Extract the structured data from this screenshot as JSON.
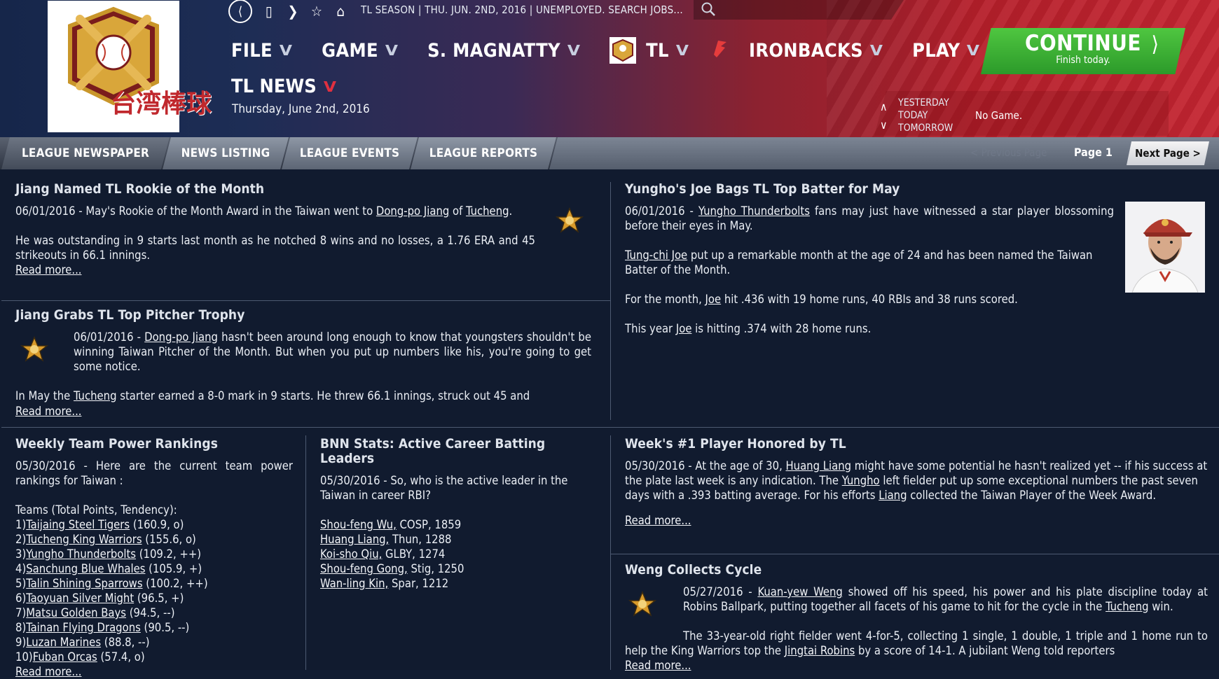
{
  "topbar": {
    "breadcrumb": "TL SEASON  |  THU. JUN. 2ND, 2016  |  UNEMPLOYED. SEARCH JOBS..."
  },
  "menus": {
    "file": "FILE",
    "game": "GAME",
    "manager": "S. MAGNATTY",
    "league": "TL",
    "team": "IRONBACKS",
    "play": "PLAY"
  },
  "page": {
    "title": "TL NEWS",
    "date": "Thursday, June 2nd, 2016"
  },
  "continue": {
    "label": "CONTINUE",
    "sub": "Finish today."
  },
  "days": {
    "yesterday": "YESTERDAY",
    "today": "TODAY",
    "tomorrow": "TOMORROW",
    "status": "No Game."
  },
  "tabs": {
    "newspaper": "LEAGUE NEWSPAPER",
    "listing": "NEWS LISTING",
    "events": "LEAGUE EVENTS",
    "reports": "LEAGUE REPORTS"
  },
  "pager": {
    "prev": "< Previous Page",
    "page": "Page 1",
    "next": "Next Page >"
  },
  "read_more": "Read more...",
  "a1": {
    "title": "Jiang Named TL Rookie of the Month",
    "p1_pre": "06/01/2016 - May's Rookie of the Month Award in the Taiwan  went to ",
    "p1_link1": "Dong-po Jiang",
    "p1_mid": " of ",
    "p1_link2": "Tucheng",
    "p1_post": ".",
    "p2": "He was outstanding in 9 starts last month as he notched 8 wins and no losses, a 1.76 ERA and 45 strikeouts in 66.1 innings."
  },
  "a2": {
    "title": "Jiang Grabs TL Top Pitcher Trophy",
    "p1_pre": "06/01/2016 - ",
    "p1_link": "Dong-po Jiang",
    "p1_post": " hasn't been around long enough to know that youngsters shouldn't be winning Taiwan  Pitcher of the Month. But when you put up numbers like his, you're going to get some notice.",
    "p2_pre": "In May the ",
    "p2_link": "Tucheng",
    "p2_post": " starter earned a 8-0 mark in 9 starts. He threw 66.1 innings, struck out 45 and"
  },
  "a3": {
    "title": "Yungho's Joe Bags TL Top Batter for May",
    "p1_pre": "06/01/2016 - ",
    "p1_link": "Yungho Thunderbolts",
    "p1_post": " fans may just have witnessed a star player blossoming before their eyes in May.",
    "p2_link": "Tung-chi Joe",
    "p2_post": " put up a remarkable month at the age of 24 and has been named the Taiwan  Batter of the Month.",
    "p3_pre": "For the month, ",
    "p3_link": "Joe",
    "p3_post": " hit .436 with 19 home runs, 40 RBIs and 38 runs scored.",
    "p4_pre": "This year ",
    "p4_link": "Joe",
    "p4_post": " is hitting .374 with 28 home runs."
  },
  "a4": {
    "title": "Weekly Team Power Rankings",
    "intro": "05/30/2016 - Here are the current team power rankings for Taiwan :",
    "header": "Teams (Total Points, Tendency):",
    "rankings": [
      {
        "num": "1)",
        "team": "Taijaing Steel Tigers",
        "stats": " (160.9, o)"
      },
      {
        "num": "2)",
        "team": "Tucheng King Warriors",
        "stats": " (155.6, o)"
      },
      {
        "num": "3)",
        "team": "Yungho Thunderbolts",
        "stats": " (109.2, ++)"
      },
      {
        "num": "4)",
        "team": "Sanchung Blue Whales",
        "stats": " (105.9, +)"
      },
      {
        "num": "5)",
        "team": "Talin Shining Sparrows",
        "stats": " (100.2, ++)"
      },
      {
        "num": "6)",
        "team": "Taoyuan Silver Might",
        "stats": " (96.5, +)"
      },
      {
        "num": "7)",
        "team": "Matsu Golden Bays",
        "stats": " (94.5, --)"
      },
      {
        "num": "8)",
        "team": "Tainan Flying Dragons",
        "stats": " (90.5, --)"
      },
      {
        "num": "9)",
        "team": "Luzan Marines",
        "stats": " (88.8, --)"
      },
      {
        "num": "10)",
        "team": "Fuban Orcas",
        "stats": " (57.4, o)"
      }
    ]
  },
  "a5": {
    "title": "BNN Stats: Active Career Batting Leaders",
    "intro": "05/30/2016 - So, who is the active leader in the Taiwan  in career RBI?",
    "leaders": [
      {
        "name": "Shou-feng Wu,",
        "stats": " COSP, 1859"
      },
      {
        "name": "Huang Liang,",
        "stats": " Thun, 1288"
      },
      {
        "name": "Koi-sho Qiu,",
        "stats": " GLBY, 1274"
      },
      {
        "name": "Shou-feng Gong,",
        "stats": " Stig, 1250"
      },
      {
        "name": "Wan-ling Kin,",
        "stats": " Spar, 1212"
      }
    ]
  },
  "a6": {
    "title": "Week's #1 Player Honored by TL",
    "p_pre": "05/30/2016 - At the age of 30, ",
    "p_link1": "Huang Liang",
    "p_mid1": " might have some potential he hasn't realized yet -- if his success at the plate last week is any indication. The ",
    "p_link2": "Yungho",
    "p_mid2": " left fielder put up some exceptional numbers the past seven days with a .393 batting average. For his efforts ",
    "p_link3": "Liang",
    "p_post": " collected the Taiwan  Player of the Week Award."
  },
  "a7": {
    "title": "Weng Collects Cycle",
    "p1_pre": "05/27/2016 - ",
    "p1_link1": "Kuan-yew Weng",
    "p1_mid": " showed off his speed, his power and his plate discipline today at Robins Ballpark, putting together all facets of his game to hit for the cycle in the ",
    "p1_link2": "Tucheng",
    "p1_post": " win.",
    "p2_pre": "The 33-year-old right fielder went 4-for-5, collecting 1 single, 1 double, 1 triple and 1 home run to help the King Warriors top the ",
    "p2_link": "Jingtai Robins",
    "p2_post": " by a score of 14-1. A jubilant Weng told reporters"
  },
  "logo_text": "台湾棒球",
  "colors": {
    "continue_green": "#3bb236",
    "header_red": "#c42531",
    "header_blue": "#16264a",
    "content_bg": "#111b2f"
  }
}
